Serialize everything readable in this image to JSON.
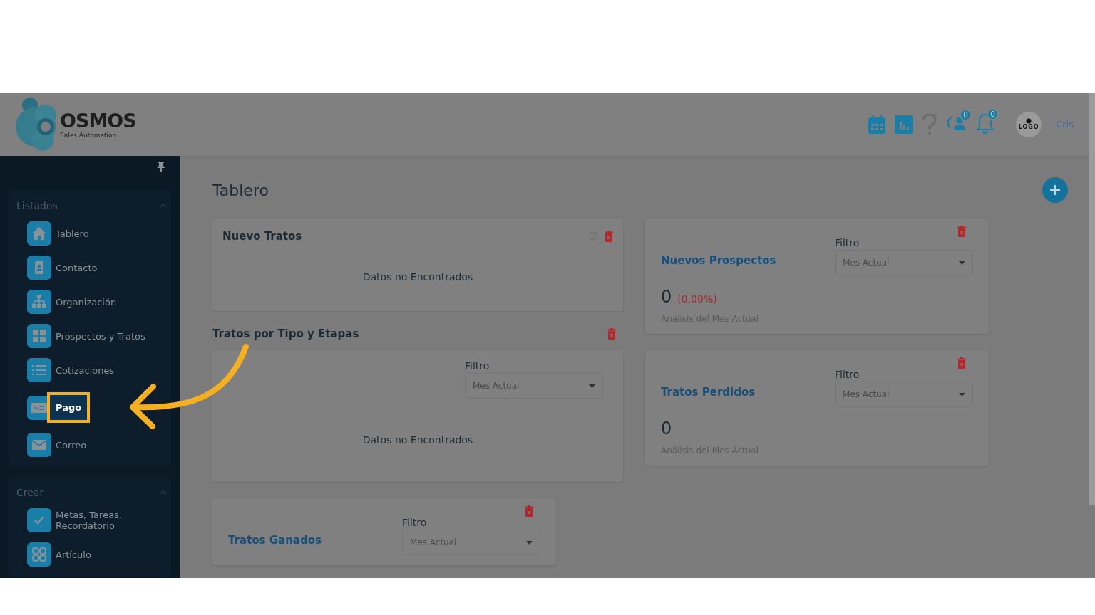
{
  "logo": {
    "name": "OSMOS",
    "tagline": "Sales Automation"
  },
  "header": {
    "contacts_badge": "0",
    "notifications_badge": "0",
    "avatar_text": "LOGO",
    "user_name": "Cris"
  },
  "sidebar": {
    "sections": [
      {
        "title": "Listados",
        "expanded": true,
        "items": [
          {
            "label": "Tablero",
            "highlighted": false
          },
          {
            "label": "Contacto",
            "highlighted": false
          },
          {
            "label": "Organización",
            "highlighted": false
          },
          {
            "label": "Prospectos y Tratos",
            "highlighted": false
          },
          {
            "label": "Cotizaciones",
            "highlighted": false
          },
          {
            "label": "Pago",
            "highlighted": true
          },
          {
            "label": "Correo",
            "highlighted": false
          }
        ]
      },
      {
        "title": "Crear",
        "expanded": true,
        "items": [
          {
            "label": "Metas, Tareas, Recordatorio",
            "highlighted": false
          },
          {
            "label": "Artículo",
            "highlighted": false
          }
        ]
      }
    ]
  },
  "page": {
    "title": "Tablero"
  },
  "left_column": [
    {
      "kind": "list",
      "title": "Nuevo Tratos",
      "message": "Datos no Encontrados"
    },
    {
      "kind": "section",
      "title": "Tratos por Tipo y Etapas",
      "filter_label": "Filtro",
      "filter_value": "Mes Actual",
      "message": "Datos no Encontrados"
    },
    {
      "kind": "stat",
      "title": "Tratos Ganados",
      "filter_label": "Filtro",
      "filter_value": "Mes Actual"
    }
  ],
  "right_column": [
    {
      "kind": "stat",
      "title": "Nuevos Prospectos",
      "filter_label": "Filtro",
      "filter_value": "Mes Actual",
      "value": "0",
      "change": "(0.00%)",
      "caption": "Análisis del Mes Actual"
    },
    {
      "kind": "stat",
      "title": "Tratos Perdidos",
      "filter_label": "Filtro",
      "filter_value": "Mes Actual",
      "value": "0",
      "caption": "Análisis del Mes Actual"
    }
  ]
}
